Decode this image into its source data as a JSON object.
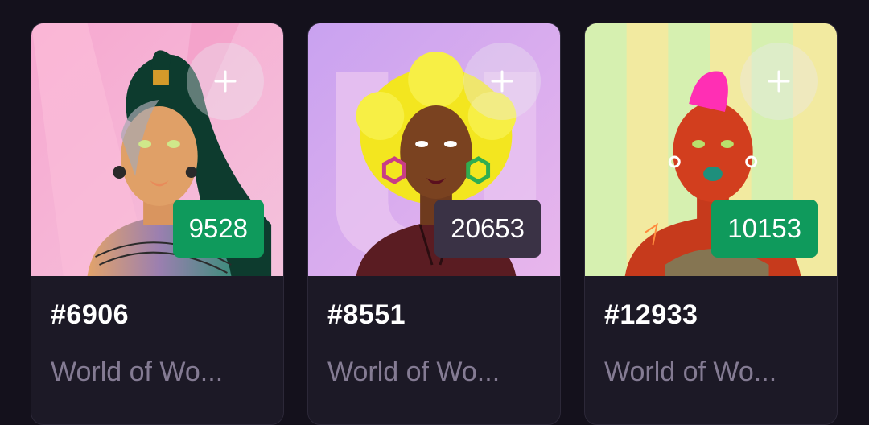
{
  "colors": {
    "background": "#14111c",
    "card": "#1c1926",
    "rank_green": "#0f9a5c",
    "rank_dark": "#3a3245",
    "muted_text": "#847b93"
  },
  "cards": [
    {
      "token_id": "#6906",
      "collection": "World of Wo...",
      "rank": "9528",
      "rank_style": "green",
      "add_icon": "plus-icon"
    },
    {
      "token_id": "#8551",
      "collection": "World of Wo...",
      "rank": "20653",
      "rank_style": "dark",
      "add_icon": "plus-icon"
    },
    {
      "token_id": "#12933",
      "collection": "World of Wo...",
      "rank": "10153",
      "rank_style": "green",
      "add_icon": "plus-icon"
    }
  ]
}
